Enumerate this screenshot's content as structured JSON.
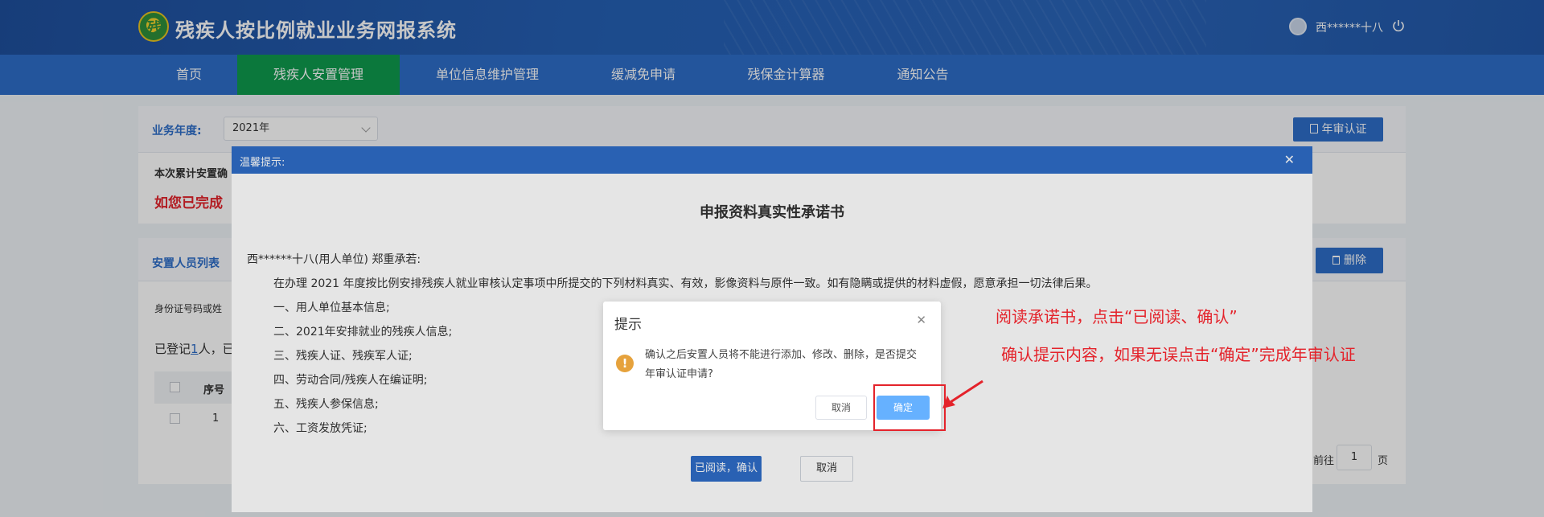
{
  "header": {
    "logo_text": "残",
    "app_title": "残疾人按比例就业业务网报系统",
    "user_name": "西******十八"
  },
  "nav": {
    "items": [
      {
        "label": "首页"
      },
      {
        "label": "残疾人安置管理",
        "active": true
      },
      {
        "label": "单位信息维护管理"
      },
      {
        "label": "缓减免申请"
      },
      {
        "label": "残保金计算器"
      },
      {
        "label": "通知公告"
      }
    ]
  },
  "filter": {
    "year_label": "业务年度:",
    "year_value": "2021年",
    "annual_button": "年审认证"
  },
  "summary": {
    "line1": "本次累计安置确",
    "line2": "如您已完成"
  },
  "list_panel": {
    "title": "安置人员列表",
    "delete_button": "删除",
    "search_label": "身份证号码或姓",
    "registered_prefix": "已登记",
    "registered_count": "1",
    "registered_suffix": "人，已",
    "col_seq": "序号",
    "row_seq": "1",
    "goto_label": "前往",
    "goto_page": "1",
    "page_suffix": "页"
  },
  "modal": {
    "header": "温馨提示:",
    "title": "申报资料真实性承诺书",
    "lines": [
      "西******十八(用人单位) 郑重承若:",
      "在办理 2021 年度按比例安排残疾人就业审核认定事项中所提交的下列材料真实、有效，影像资料与原件一致。如有隐瞒或提供的材料虚假，愿意承担一切法律后果。",
      "一、用人单位基本信息;",
      "二、2021年安排就业的残疾人信息;",
      "三、残疾人证、残疾军人证;",
      "四、劳动合同/残疾人在编证明;",
      "五、残疾人参保信息;",
      "六、工资发放凭证;"
    ],
    "confirm_button": "已阅读，确认",
    "cancel_button": "取消"
  },
  "confirm_dialog": {
    "title": "提示",
    "message": "确认之后安置人员将不能进行添加、修改、删除，是否提交年审认证申请?",
    "cancel": "取消",
    "ok": "确定"
  },
  "annotations": {
    "line1": "阅读承诺书，点击“已阅读、确认”",
    "line2": "确认提示内容，如果无误点击“确定”完成年审认证"
  },
  "colors": {
    "nav_blue": "#2e6dc8",
    "nav_active_green": "#0f9a4d",
    "annotation_red": "#e4232b",
    "ok_button": "#66b1ff"
  }
}
